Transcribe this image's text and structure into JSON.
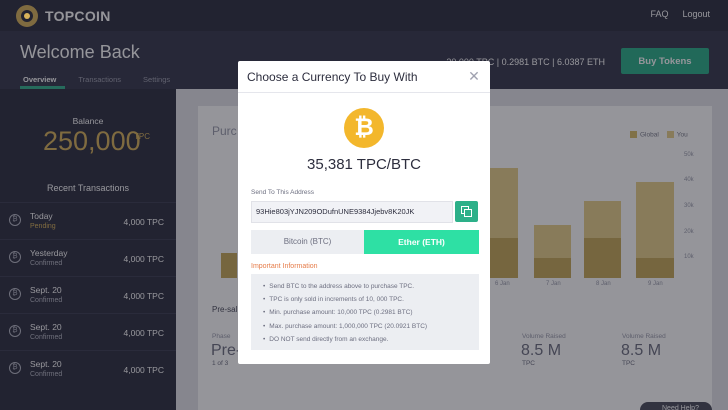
{
  "app": {
    "brand": "TOPCOIN"
  },
  "nav": {
    "faq": "FAQ",
    "logout": "Logout"
  },
  "header": {
    "title": "Welcome Back",
    "tabs": [
      "Overview",
      "Transactions",
      "Settings"
    ],
    "balances": "20,000 TPC | 0.2981 BTC | 6.0387 ETH",
    "buy_label": "Buy Tokens"
  },
  "sidebar": {
    "balance_label": "Balance",
    "balance_value": "250,000",
    "balance_unit": "TPC",
    "recent_title": "Recent Transactions",
    "transactions": [
      {
        "date": "Today",
        "status": "Pending",
        "amount": "4,000 TPC"
      },
      {
        "date": "Yesterday",
        "status": "Confirmed",
        "amount": "4,000 TPC"
      },
      {
        "date": "Sept. 20",
        "status": "Confirmed",
        "amount": "4,000 TPC"
      },
      {
        "date": "Sept. 20",
        "status": "Confirmed",
        "amount": "4,000 TPC"
      },
      {
        "date": "Sept. 20",
        "status": "Confirmed",
        "amount": "4,000 TPC"
      }
    ]
  },
  "background": {
    "card_title": "Purc",
    "legend": [
      {
        "label": "Global",
        "color": "#d9bd6a"
      },
      {
        "label": "You",
        "color": "#e8cf8a"
      }
    ],
    "yticks": [
      "50k",
      "40k",
      "30k",
      "20k",
      "10k"
    ],
    "xticks": [
      "6 Jan",
      "7 Jan",
      "8 Jan",
      "9 Jan"
    ],
    "presale_label": "Pre-sal",
    "phase_label": "Phase",
    "phase_value": "Pre-",
    "phase_sub": "1 of 3",
    "volume_label_1": "Volume Raised",
    "volume_value_1": "8.5 M",
    "volume_unit_1": "TPC",
    "volume_label_2": "Volume Raised",
    "volume_value_2": "8.5 M",
    "volume_unit_2": "TPC",
    "help_label": "Need Help?"
  },
  "modal": {
    "title": "Choose a Currency To Buy With",
    "close_icon": "close-icon",
    "coin_icon": "bitcoin-icon",
    "rate": "35,381 TPC/BTC",
    "send_label": "Send To This Address",
    "address": "93Hie803jYJN209ODufnUNE9384Jjebv8K20JK",
    "tabs": {
      "btc": "Bitcoin (BTC)",
      "eth": "Ether (ETH)"
    },
    "info_label": "Important Information",
    "info_items": [
      "Send BTC to the address above to purchase TPC.",
      "TPC is only sold in increments of 10, 000 TPC.",
      "Min. purchase amount: 10,000 TPC (0.2981 BTC)",
      "Max. purchase amount: 1,000,000 TPC (20.0921 BTC)",
      "DO NOT send directly from an exchange."
    ]
  },
  "colors": {
    "accent": "#2db089",
    "eth_tab": "#2ee0a4",
    "gold": "#d8b35b",
    "bitcoin": "#f3b72c",
    "warning": "#e67c49"
  }
}
